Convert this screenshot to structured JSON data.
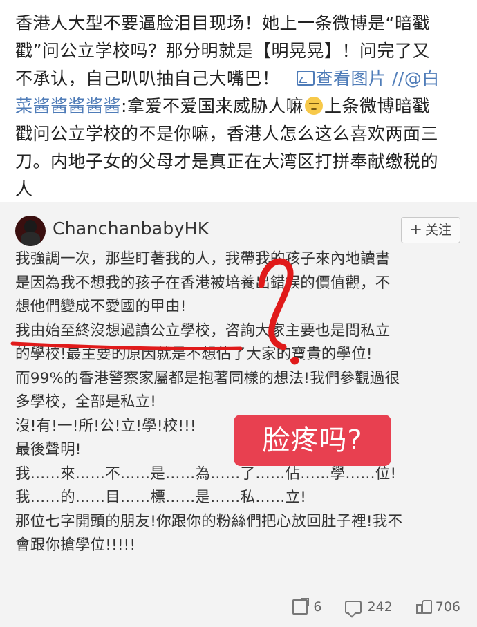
{
  "post": {
    "line1": "香港人大型不要逼脸泪目现场！她上一条微博是“暗戳",
    "line2": "戳”问公立学校吗？那分明就是【明晃晃】！问完了又",
    "line3_text": "不承认，自己叭叭抽自己大嘴巴！",
    "view_image_label": "查看图片",
    "mention_prefix": " //@白",
    "line4_mention": "菜酱酱酱酱酱",
    "line4_text": ":拿爱不爱国来威胁人嘛",
    "line4_tail": "上条微博暗戳",
    "line5": "戳问公立学校的不是你嘛，香港人怎么这么喜欢两面三",
    "line6": "刀。内地子女的父母才是真正在大湾区打拼奉献缴税的",
    "line7": "人"
  },
  "repost": {
    "username": "ChanchanbabyHK",
    "follow_label": "关注",
    "follow_plus": "+",
    "lines": [
      "我強調一次，那些盯著我的人，我帶我的孩子來內地讀書",
      "是因為我不想我的孩子在香港被培養出錯誤的價值觀，不",
      "想他們變成不愛國的甲由!",
      "我由始至終沒想過讀公立學校，咨詢大家主要也是問私立",
      "的學校!最主要的原因就是不想佔了大家的寶貴的學位!",
      "而99%的香港警察家屬都是抱著同樣的想法!我們參觀過很",
      "多學校，全部是私立!",
      "沒!有!一!所!公!立!學!校!!!",
      "最後聲明!",
      "我……來……不……是……為……了……佔……學……位!",
      "我……的……目……標……是……私……立!",
      "那位七字開頭的朋友!你跟你的粉絲們把心放回肚子裡!我不",
      "會跟你搶學位!!!!!"
    ],
    "sticker_text": "脸疼吗?",
    "actions": {
      "shares": "6",
      "comments": "242",
      "likes": "706"
    }
  },
  "colors": {
    "link": "#4f7cb8",
    "annotation_red": "#e01a1a",
    "sticker_bg": "#e84050",
    "repost_bg": "#f3f3f3"
  }
}
